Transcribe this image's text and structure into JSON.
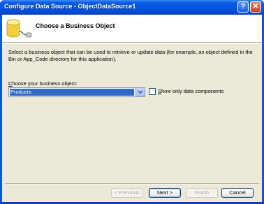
{
  "window": {
    "title": "Configure Data Source - ObjectDataSource1",
    "help_glyph": "?",
    "close_glyph": "✕"
  },
  "header": {
    "title": "Choose a Business Object",
    "icon": "database-plug-icon"
  },
  "description": "Select a business object that can be used to retrieve or update data (for example, an object defined in the Bin or App_Code directory for this application).",
  "business_object": {
    "label_prefix": "C",
    "label_rest": "hoose your business object:",
    "selected": "Products"
  },
  "show_only_data_components": {
    "label_prefix": "S",
    "label_rest": "how only data components",
    "checked": false
  },
  "buttons": {
    "previous": "< Previous",
    "next": "Next >",
    "finish": "Finish",
    "cancel": "Cancel"
  },
  "colors": {
    "titlebar": "#0554e0",
    "selection": "#316ac5",
    "dialog_bg": "#ece9d8"
  }
}
